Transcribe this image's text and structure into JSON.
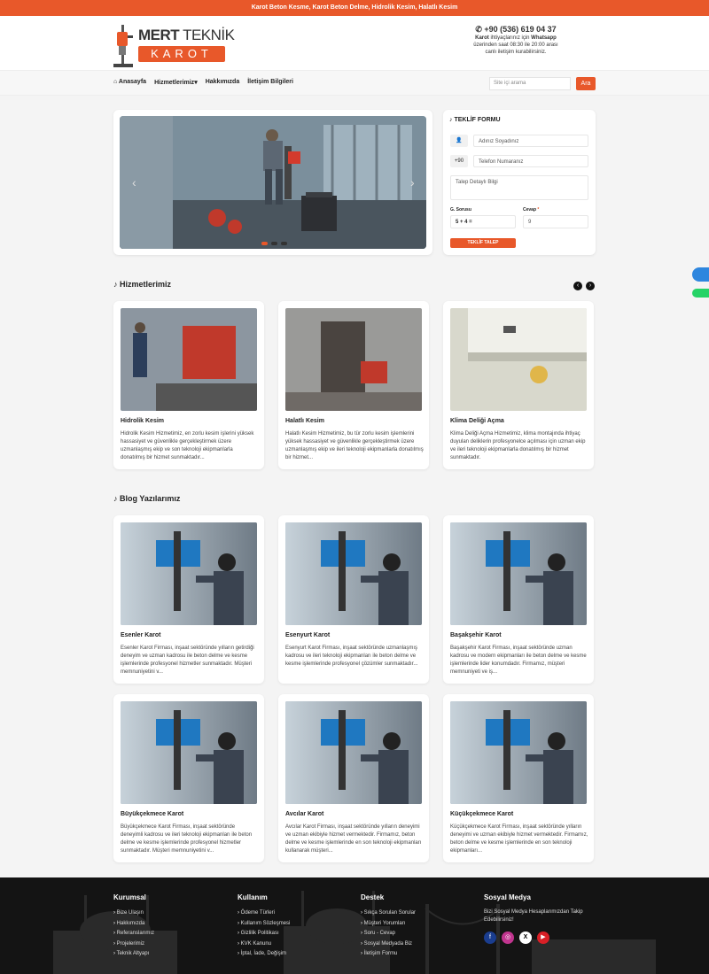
{
  "topbar": {
    "text": "Karot Beton Kesme, Karot Beton Delme, Hidrolik Kesim, Halatlı Kesim"
  },
  "logo": {
    "line1_bold": "MERT",
    "line1_rest": " TEKNİK",
    "line2": "KAROT"
  },
  "contact": {
    "phone": "+90 (536) 619 04 37",
    "line1_brand": "Karot",
    "line1_mid": " ihtiyaçlarınız için ",
    "line1_end": "Whatsapp",
    "line2": "üzerinden saat 08:30 ile 20:00 arası",
    "line3": "canlı iletişim kurabilirsiniz."
  },
  "nav": {
    "items": [
      "Anasayfa",
      "Hizmetlerimiz",
      "Hakkımızda",
      "İletişim Bilgileri"
    ],
    "search_placeholder": "Site içi arama",
    "search_button": "Ara"
  },
  "form": {
    "title": "TEKLİF FORMU",
    "name_placeholder": "Adınız Soyadınız",
    "country_code": "+90",
    "phone_placeholder": "Telefon Numaranız",
    "detail_placeholder": "Talep Detaylı Bilgi",
    "question_label": "G. Sorusu",
    "question": "5 + 4 =",
    "answer_label": "Cevap",
    "answer_required": "*",
    "answer_placeholder": "9",
    "submit": "TEKLİF TALEP"
  },
  "services": {
    "title": "Hizmetlerimiz",
    "items": [
      {
        "title": "Hidrolik Kesim",
        "desc": "Hidrolik Kesim Hizmetimiz, en zorlu kesim işlerini yüksek hassasiyet ve güvenlikle gerçekleştirmek üzere uzmanlaşmış ekip ve son teknoloji ekipmanlarla donatılmış bir hizmet sunmaktadır..."
      },
      {
        "title": "Halatlı Kesim",
        "desc": "Halatlı Kesim Hizmetimiz, bu tür zorlu kesim işlemlerini yüksek hassasiyet ve güvenlikle gerçekleştirmek üzere uzmanlaşmış ekip ve ileri teknoloji ekipmanlarla donatılmış bir hizmet..."
      },
      {
        "title": "Klima Deliği Açma",
        "desc": "Klima Deliği Açma Hizmetimiz, klima montajında ihtiyaç duyulan deliklerin profesyonelce açılması için uzman ekip ve ileri teknoloji ekipmanlarla donatılmış bir hizmet sunmaktadır."
      }
    ]
  },
  "blog": {
    "title": "Blog Yazılarımız",
    "items": [
      {
        "title": "Esenler Karot",
        "desc": "Esenler Karot Firması, inşaat sektöründe yılların getirdiği deneyim ve uzman kadrosu ile beton delme ve kesme işlemlerinde profesyonel hizmetler sunmaktadır. Müşteri memnuniyetini v..."
      },
      {
        "title": "Esenyurt Karot",
        "desc": "Esenyurt Karot Firması, inşaat sektöründe uzmanlaşmış kadrosu ve ileri teknoloji ekipmanları ile beton delme ve kesme işlemlerinde profesyonel çözümler sunmaktadır..."
      },
      {
        "title": "Başakşehir Karot",
        "desc": "Başakşehir Karot Firması, inşaat sektöründe uzman kadrosu ve modern ekipmanları ile beton delme ve kesme işlemlerinde lider konumdadır. Firmamız, müşteri memnuniyeti ve iş..."
      },
      {
        "title": "Büyükçekmece Karot",
        "desc": "Büyükçekmece Karot Firması, inşaat sektöründe deneyimli kadrosu ve ileri teknoloji ekipmanları ile beton delme ve kesme işlemlerinde profesyonel hizmetler sunmaktadır. Müşteri memnuniyetini v..."
      },
      {
        "title": "Avcılar Karot",
        "desc": "Avcılar Karot Firması, inşaat sektöründe yılların deneyimi ve uzman ekibiyle hizmet vermektedir. Firmamız, beton delme ve kesme işlemlerinde en son teknoloji ekipmanları kullanarak müşteri..."
      },
      {
        "title": "Küçükçekmece Karot",
        "desc": "Küçükçekmece Karot Firması, inşaat sektöründe yılların deneyimi ve uzman ekibiyle hizmet vermektedir. Firmamız, beton delme ve kesme işlemlerinde en son teknoloji ekipmanları..."
      }
    ]
  },
  "footer": {
    "cols": [
      {
        "title": "Kurumsal",
        "items": [
          "Bize Ulaşın",
          "Hakkımızda",
          "Referanslarımız",
          "Projelerimiz",
          "Teknik Altyapı"
        ]
      },
      {
        "title": "Kullanım",
        "items": [
          "Ödeme Türleri",
          "Kullanım Sözleşmesi",
          "Gizlilik Politikası",
          "KVK Kanunu",
          "İptal, İade, Değişim"
        ]
      },
      {
        "title": "Destek",
        "items": [
          "Sıkça Sorulan Sorular",
          "Müşteri Yorumları",
          "Soru - Cevap",
          "Sosyal Medyada Biz",
          "İletişim Formu"
        ]
      }
    ],
    "social_title": "Sosyal Medya",
    "social_text": "Bizi Sosyal Medya Hesaplarımızdan Takip Edebilirsiniz!",
    "social_icons": [
      {
        "name": "facebook",
        "glyph": "f",
        "color": "#1a3d8f"
      },
      {
        "name": "instagram",
        "glyph": "◎",
        "color": "#c1358f"
      },
      {
        "name": "x",
        "glyph": "X",
        "color": "#ffffff"
      },
      {
        "name": "youtube",
        "glyph": "▶",
        "color": "#d81f26"
      }
    ]
  }
}
